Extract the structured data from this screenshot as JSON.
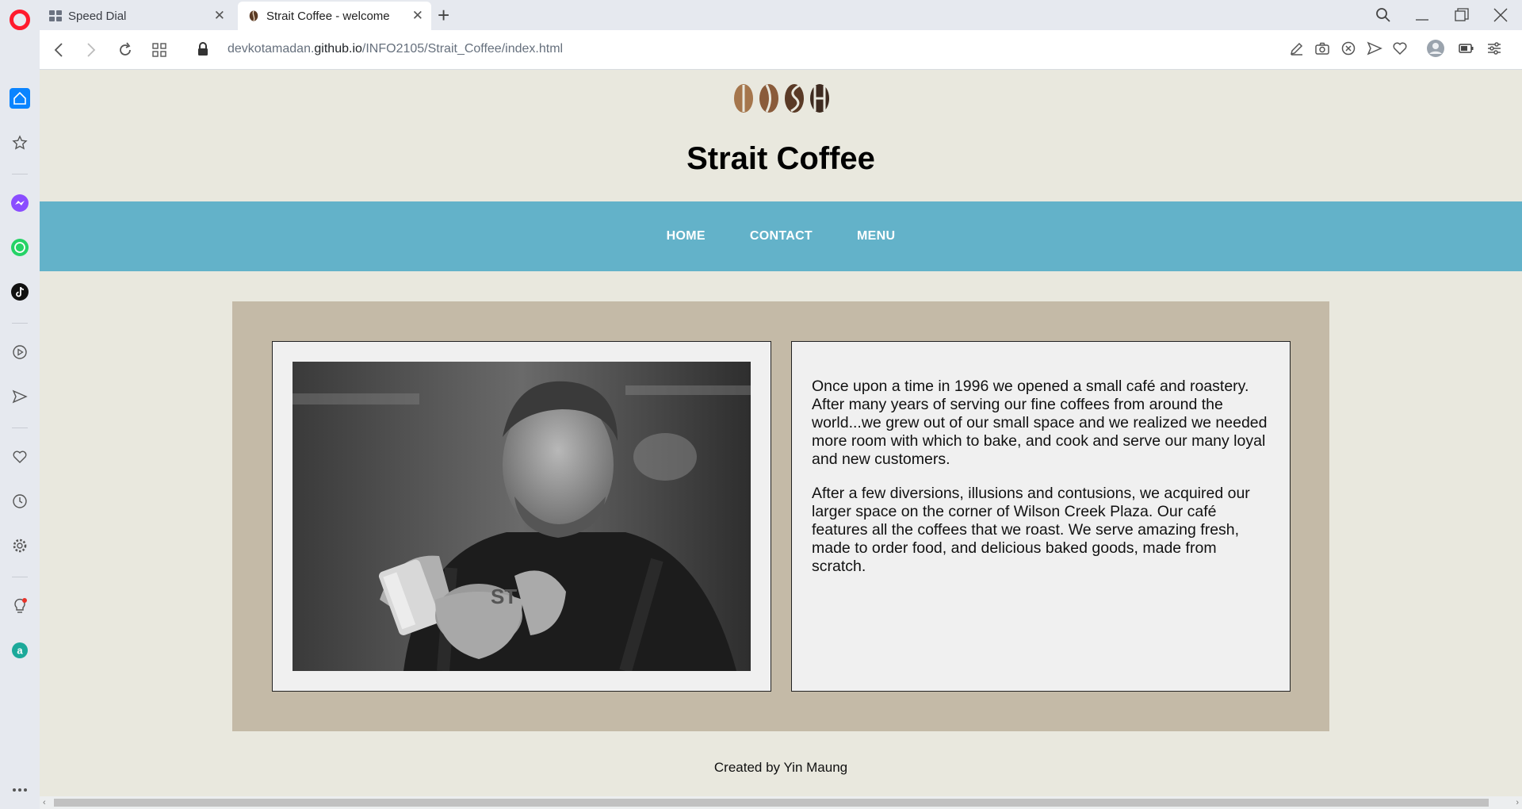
{
  "browser": {
    "tabs": [
      {
        "label": "Speed Dial",
        "active": false
      },
      {
        "label": "Strait Coffee - welcome",
        "active": true
      }
    ],
    "url_prefix": "devkotamadan.",
    "url_domain": "github.io",
    "url_path": "/INFO2105/Strait_Coffee/index.html"
  },
  "site": {
    "title": "Strait Coffee",
    "nav": [
      "HOME",
      "CONTACT",
      "MENU"
    ],
    "paragraphs": [
      "Once upon a time in 1996 we opened a small café and roastery. After many years of serving our fine coffees from around the world...we grew out of our small space and we realized we needed more room with which to bake, and cook and serve our many loyal and new customers.",
      "After a few diversions, illusions and contusions, we acquired our larger space on the corner of Wilson Creek Plaza. Our café features all the coffees that we roast. We serve amazing fresh, made to order food, and delicious baked goods, made from scratch."
    ],
    "footer": "Created by Yin Maung"
  },
  "colors": {
    "nav_bg": "#63b2c9",
    "page_bg": "#e9e8de",
    "main_bg": "#c4baa7",
    "card_bg": "#f0f0f0"
  },
  "icons": {
    "sidebar": [
      "home-icon",
      "speed-dial-icon",
      "messenger-icon",
      "whatsapp-icon",
      "tiktok-icon",
      "player-icon",
      "flow-icon",
      "bookmarks-icon",
      "history-icon",
      "settings-icon",
      "tips-icon",
      "aria-icon",
      "more-icon"
    ]
  }
}
